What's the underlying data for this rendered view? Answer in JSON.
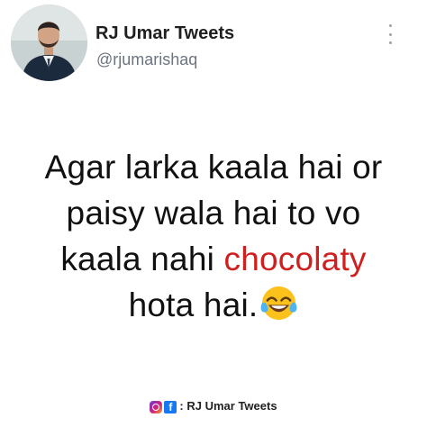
{
  "profile": {
    "display_name": "RJ Umar Tweets",
    "handle": "@rjumarishaq"
  },
  "tweet": {
    "line1": "Agar larka kaala hai or",
    "line2": "paisy wala hai to vo",
    "line3_start": "kaala nahi ",
    "line3_highlight": "chocolaty",
    "line4": "hota hai.",
    "emoji": "tears-of-joy-emoji",
    "highlight_color": "#d01f1f"
  },
  "footer": {
    "instagram_icon": "instagram-icon",
    "facebook_icon": "facebook-icon",
    "credit": ": RJ Umar Tweets"
  },
  "colors": {
    "text": "#111111",
    "handle": "#6b7480",
    "accent_red": "#d01f1f"
  }
}
